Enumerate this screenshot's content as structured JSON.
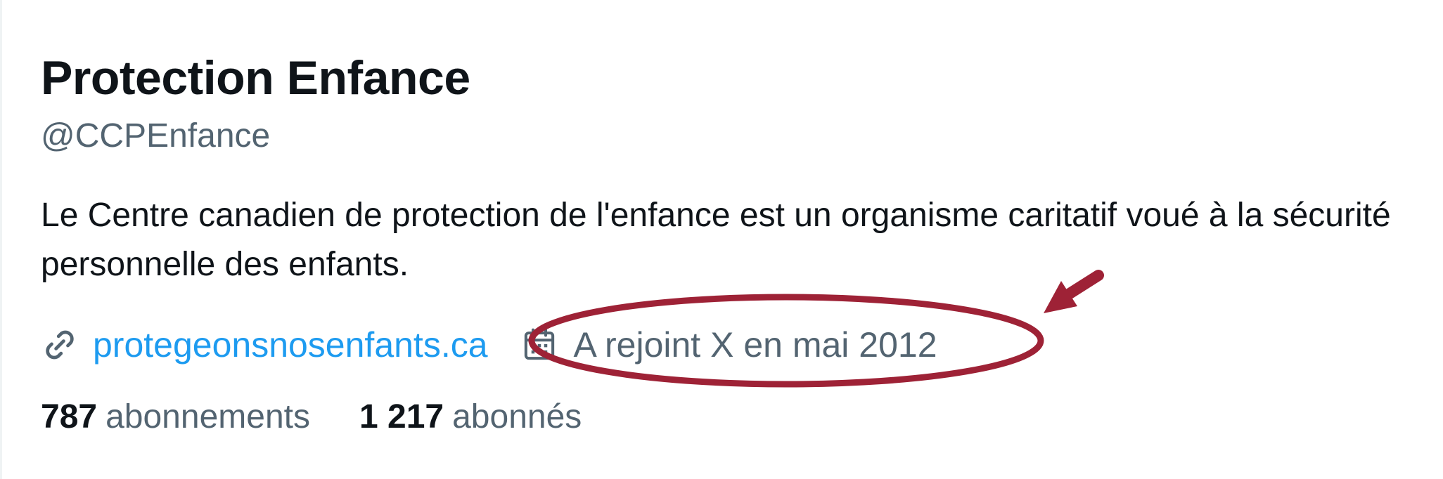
{
  "profile": {
    "display_name": "Protection Enfance",
    "handle": "@CCPEnfance",
    "bio": "Le Centre canadien de protection de l'enfance est un organisme caritatif voué à la sécurité personnelle des enfants.",
    "website": "protegeonsnosenfants.ca",
    "joined": "A rejoint X en mai 2012",
    "link_icon": "link-icon",
    "calendar_icon": "calendar-icon"
  },
  "stats": {
    "following_count": "787",
    "following_label": "abonnements",
    "followers_count": "1 217",
    "followers_label": "abonnés"
  },
  "colors": {
    "text_primary": "#0f1419",
    "text_secondary": "#536471",
    "link": "#1d9bf0",
    "annotation": "#9e2236"
  }
}
